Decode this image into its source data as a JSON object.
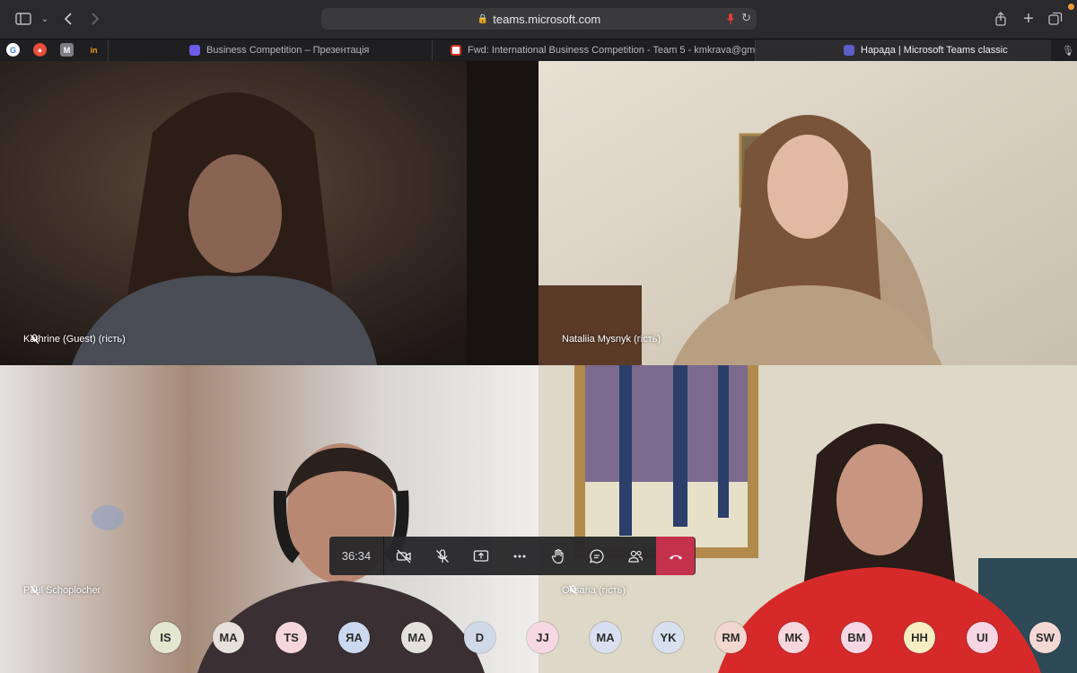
{
  "browser": {
    "url": "teams.microsoft.com",
    "tabs": [
      {
        "label": "Business Competition – Презентація",
        "icon": "slides-icon"
      },
      {
        "label": "Fwd: International Business Competition - Team 5 - kmkrava@gmail.c...",
        "icon": "gmail-icon"
      },
      {
        "label": "Нарада | Microsoft Teams classic",
        "icon": "teams-icon"
      }
    ],
    "favorites": [
      {
        "glyph": "G",
        "color": "#4285f4"
      },
      {
        "glyph": "●",
        "color": "#e74c3c"
      },
      {
        "glyph": "M",
        "color": "#7d7d86"
      },
      {
        "glyph": "in",
        "color": "#f7931e"
      }
    ]
  },
  "call": {
    "timer": "36:34",
    "tiles": [
      {
        "name": "Kathrine (Guest) (гість)"
      },
      {
        "name": "Nataliia Mysnyk (гість)"
      },
      {
        "name": "Paul Schoplocher"
      },
      {
        "name": "Oksana (гість)"
      }
    ],
    "controls": [
      {
        "name": "camera-off-button",
        "icon": "camera-off-icon"
      },
      {
        "name": "mic-off-button",
        "icon": "mic-off-icon"
      },
      {
        "name": "share-screen-button",
        "icon": "share-screen-icon"
      },
      {
        "name": "more-actions-button",
        "icon": "more-icon"
      },
      {
        "name": "raise-hand-button",
        "icon": "hand-icon"
      },
      {
        "name": "chat-button",
        "icon": "chat-icon"
      },
      {
        "name": "participants-button",
        "icon": "people-icon"
      },
      {
        "name": "hangup-button",
        "icon": "phone-hangup-icon"
      }
    ],
    "participants": [
      {
        "initials": "IS",
        "color": "#e3e7cf"
      },
      {
        "initials": "MA",
        "color": "#e5e1da"
      },
      {
        "initials": "TS",
        "color": "#f5d6dc"
      },
      {
        "initials": "ЯА",
        "color": "#cbd8ee"
      },
      {
        "initials": "MA",
        "color": "#e4e0dc"
      },
      {
        "initials": "D",
        "color": "#cfd9e8"
      },
      {
        "initials": "JJ",
        "color": "#f6d8e2"
      },
      {
        "initials": "MA",
        "color": "#d8dff0"
      },
      {
        "initials": "YK",
        "color": "#d7e0ef"
      },
      {
        "initials": "RM",
        "color": "#f1d7cf"
      },
      {
        "initials": "MK",
        "color": "#f5d7dd"
      },
      {
        "initials": "BM",
        "color": "#f6d6e3"
      },
      {
        "initials": "HH",
        "color": "#f6eec3"
      },
      {
        "initials": "UI",
        "color": "#f6d6e2"
      },
      {
        "initials": "SW",
        "color": "#f4d8d4"
      }
    ]
  }
}
